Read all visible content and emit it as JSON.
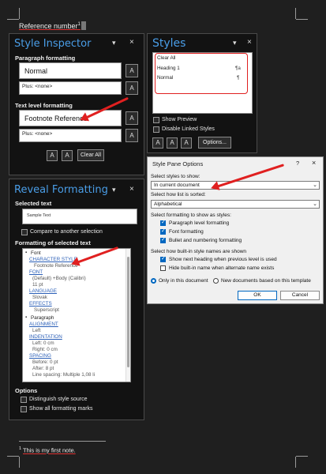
{
  "document": {
    "reference_text": "Reference number",
    "reference_superscript": "1",
    "footnote_number": "1",
    "footnote_text": "This is my first note."
  },
  "style_inspector": {
    "title": "Style Inspector",
    "paragraph_formatting_label": "Paragraph formatting",
    "paragraph_style": "Normal",
    "paragraph_plus": "Plus: <none>",
    "text_level_label": "Text level formatting",
    "text_style": "Footnote Reference",
    "text_plus": "Plus: <none>",
    "clear_all": "Clear All"
  },
  "styles_pane": {
    "title": "Styles",
    "items": [
      {
        "name": "Clear All",
        "mark": ""
      },
      {
        "name": "Heading 1",
        "mark": "¶a"
      },
      {
        "name": "Normal",
        "mark": "¶"
      }
    ],
    "show_preview": "Show Preview",
    "disable_linked": "Disable Linked Styles",
    "options": "Options..."
  },
  "reveal_formatting": {
    "title": "Reveal Formatting",
    "selected_text_label": "Selected text",
    "sample_text": "Sample Text",
    "compare_label": "Compare to another selection",
    "formatting_label": "Formatting of selected text",
    "options_label": "Options",
    "distinguish_label": "Distinguish style source",
    "show_all_label": "Show all formatting marks",
    "tree": [
      {
        "text": "Font",
        "kind": "header"
      },
      {
        "text": "CHARACTER STYLE",
        "kind": "link"
      },
      {
        "text": "Footnote Reference",
        "kind": "value"
      },
      {
        "text": "FONT",
        "kind": "link"
      },
      {
        "text": "(Default) +Body (Calibri)",
        "kind": "value"
      },
      {
        "text": "11 pt",
        "kind": "value"
      },
      {
        "text": "LANGUAGE",
        "kind": "link"
      },
      {
        "text": "Slovak",
        "kind": "value"
      },
      {
        "text": "EFFECTS",
        "kind": "link"
      },
      {
        "text": "Superscript",
        "kind": "value"
      },
      {
        "text": "Paragraph",
        "kind": "header"
      },
      {
        "text": "ALIGNMENT",
        "kind": "link"
      },
      {
        "text": "Left",
        "kind": "value"
      },
      {
        "text": "INDENTATION",
        "kind": "link"
      },
      {
        "text": "Left: 0 cm",
        "kind": "value"
      },
      {
        "text": "Right: 0 cm",
        "kind": "value"
      },
      {
        "text": "SPACING",
        "kind": "link"
      },
      {
        "text": "Before: 0 pt",
        "kind": "value"
      },
      {
        "text": "After: 8 pt",
        "kind": "value"
      },
      {
        "text": "Line spacing: Multiple 1,08 li",
        "kind": "value"
      }
    ]
  },
  "dialog": {
    "title": "Style Pane Options",
    "help": "?",
    "close": "×",
    "select_styles_label": "Select styles to show:",
    "select_styles_value": "In current document",
    "sort_label": "Select how list is sorted:",
    "sort_value": "Alphabetical",
    "formatting_label": "Select formatting to show as styles:",
    "paragraph_level": "Paragraph level formatting",
    "font_formatting": "Font formatting",
    "bullet_numbering": "Bullet and numbering formatting",
    "builtin_label": "Select how built-in style names are shown",
    "show_next_heading": "Show next heading when previous level is used",
    "hide_builtin": "Hide built-in name when alternate name exists",
    "only_this_doc": "Only in this document",
    "new_docs": "New documents based on this template",
    "ok": "OK",
    "cancel": "Cancel"
  },
  "colors": {
    "accent_blue": "#4a9ee8",
    "annotation_red": "#e02020",
    "link_blue": "#2b5fb7"
  }
}
